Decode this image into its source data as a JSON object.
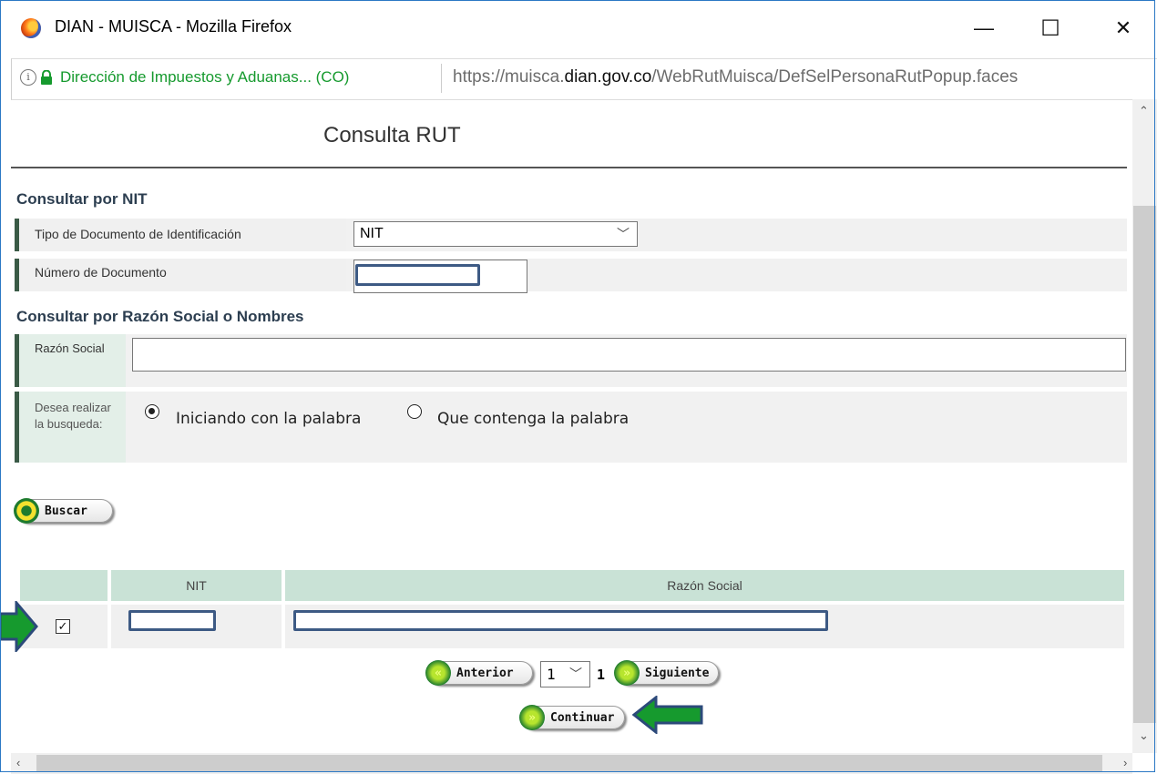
{
  "window": {
    "title": "DIAN - MUISCA - Mozilla Firefox",
    "minimize": "—",
    "maximize": "☐",
    "close": "✕"
  },
  "urlbar": {
    "site_identity": "Dirección de Impuestos y Aduanas... (CO)",
    "url_prefix": "https://muisca.",
    "url_domain": "dian.gov.co",
    "url_path": "/WebRutMuisca/DefSelPersonaRutPopup.faces"
  },
  "page": {
    "title": "Consulta RUT"
  },
  "nit_section": {
    "title": "Consultar por NIT",
    "doc_type_label": "Tipo de Documento de Identificación",
    "doc_type_value": "NIT",
    "doc_number_label": "Número de Documento"
  },
  "name_section": {
    "title": "Consultar por Razón Social o Nombres",
    "razon_label": "Razón Social",
    "search_label": "Desea realizar la busqueda:",
    "option_starts": "Iniciando con la palabra",
    "option_contains": "Que contenga la palabra"
  },
  "buttons": {
    "search": "Buscar",
    "previous": "Anterior",
    "next": "Siguiente",
    "continue": "Continuar"
  },
  "results": {
    "columns": [
      "NIT",
      "Razón Social"
    ],
    "row_checked": "☑"
  },
  "pagination": {
    "page_value": "1",
    "total_pages": "1"
  },
  "icons": {
    "next": "»",
    "prev": "«"
  },
  "colors": {
    "header_green": "#c9e2d6",
    "accent_green": "#1e7b2e",
    "redaction_blue": "#3d5a84"
  }
}
